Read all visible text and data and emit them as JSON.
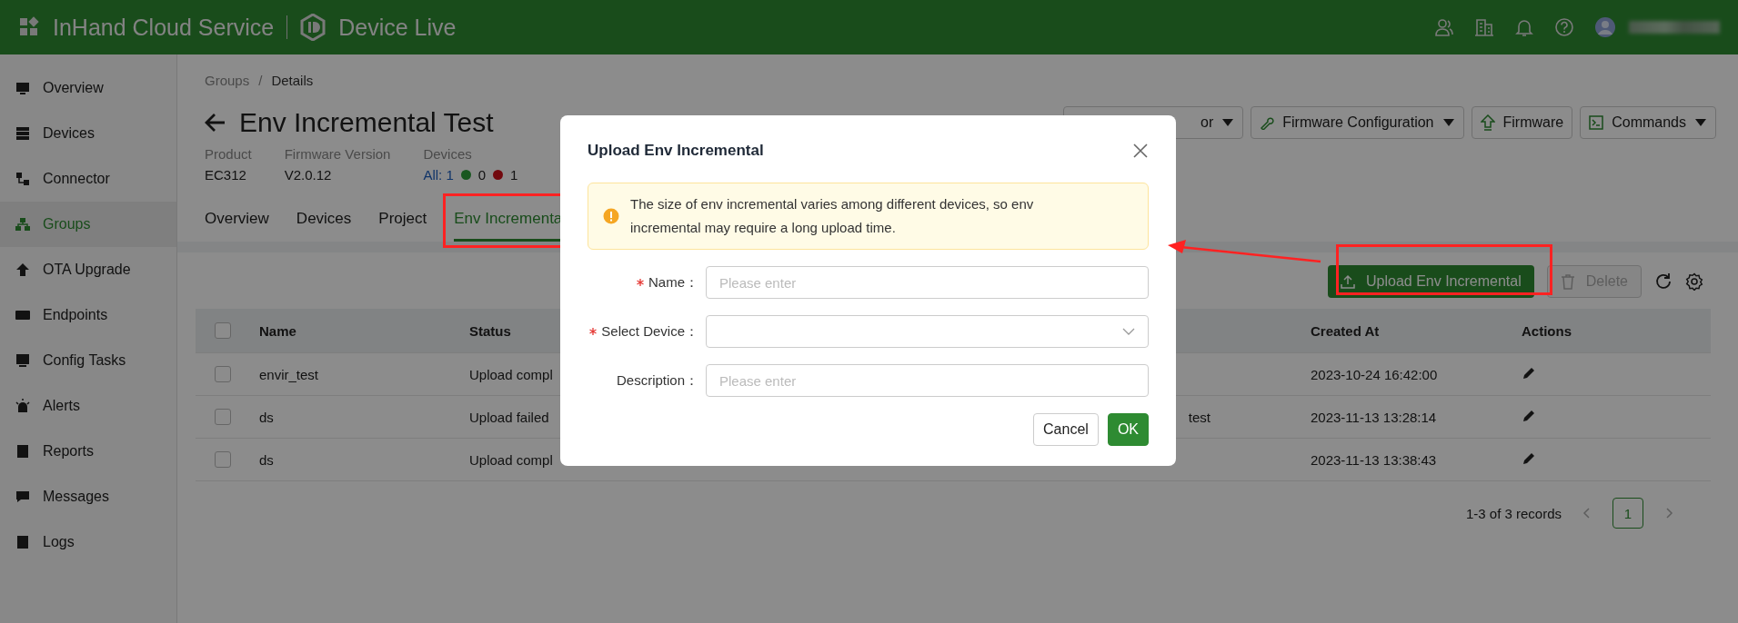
{
  "header": {
    "app_name": "InHand Cloud Service",
    "product_name": "Device Live"
  },
  "sidebar": {
    "items": [
      {
        "label": "Overview",
        "selected": false
      },
      {
        "label": "Devices",
        "selected": false
      },
      {
        "label": "Connector",
        "selected": false
      },
      {
        "label": "Groups",
        "selected": true
      },
      {
        "label": "OTA Upgrade",
        "selected": false
      },
      {
        "label": "Endpoints",
        "selected": false
      },
      {
        "label": "Config Tasks",
        "selected": false
      },
      {
        "label": "Alerts",
        "selected": false
      },
      {
        "label": "Reports",
        "selected": false
      },
      {
        "label": "Messages",
        "selected": false
      },
      {
        "label": "Logs",
        "selected": false
      }
    ]
  },
  "breadcrumb": [
    "Groups",
    "Details"
  ],
  "breadcrumb_separator": "/",
  "page_title": "Env Incremental Test",
  "meta": [
    {
      "kind": "text",
      "label": "Product",
      "value": "EC312"
    },
    {
      "kind": "text",
      "label": "Firmware Version",
      "value": "V2.0.12"
    },
    {
      "kind": "counts",
      "label": "Devices",
      "all": "All: 1",
      "online": "0",
      "offline": "1"
    }
  ],
  "header_buttons": [
    {
      "label": "or",
      "kind": "dropdown"
    },
    {
      "label": "Firmware Configuration",
      "kind": "dropdown"
    },
    {
      "label": "Firmware",
      "kind": "plain"
    },
    {
      "label": "Commands",
      "kind": "dropdown"
    }
  ],
  "tabs": [
    {
      "label": "Overview",
      "selected": false
    },
    {
      "label": "Devices",
      "selected": false
    },
    {
      "label": "Project",
      "selected": false
    },
    {
      "label": "Env Incrementa",
      "selected": true
    }
  ],
  "toolbar": {
    "upload": "Upload Env Incremental",
    "delete": {
      "label": "Delete",
      "disabled": true
    }
  },
  "table": {
    "header_checked": false,
    "columns": [
      "Name",
      "Status",
      "Created At",
      "Actions"
    ],
    "rows": [
      {
        "checked": false,
        "name": "envir_test",
        "status": "Upload compl",
        "created_at": "2023-10-24 16:42:00"
      },
      {
        "checked": false,
        "name": "ds",
        "status": "Upload failed",
        "column_3": "test",
        "created_at": "2023-11-13 13:28:14"
      },
      {
        "checked": false,
        "name": "ds",
        "status": "Upload compl",
        "created_at": "2023-11-13 13:38:43"
      }
    ]
  },
  "pagination": {
    "summary": "1-3 of 3 records",
    "pages": [
      {
        "label": "1",
        "selected": true
      }
    ]
  },
  "dialog": {
    "title": "Upload Env Incremental",
    "alert": "The size of env incremental varies among different devices, so env incremental may require a long upload time.",
    "fields": [
      {
        "kind": "text",
        "label": "Name：",
        "required": true,
        "placeholder": "Please enter"
      },
      {
        "kind": "select",
        "label": "Select Device：",
        "required": true
      },
      {
        "kind": "text",
        "label": "Description：",
        "required": false,
        "placeholder": "Please enter"
      }
    ],
    "buttons": [
      {
        "label": "Cancel",
        "kind": "secondary"
      },
      {
        "label": "OK",
        "kind": "primary"
      }
    ]
  }
}
